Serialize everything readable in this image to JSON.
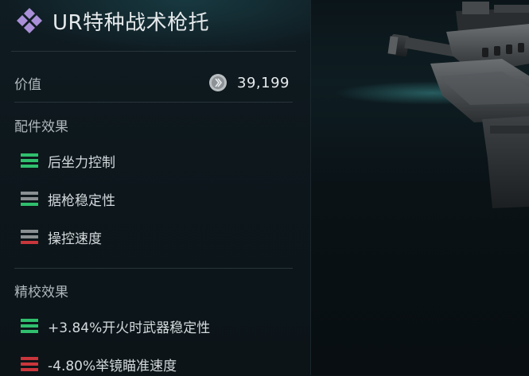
{
  "item": {
    "title": "UR特种战术枪托",
    "rarity_color": "#a98fd8"
  },
  "value": {
    "label": "价值",
    "amount": "39,199",
    "currency_icon": "silver-coin-icon"
  },
  "attachment_effects": {
    "title": "配件效果",
    "items": [
      {
        "label": "后坐力控制",
        "bars": [
          "#2fbf6d",
          "#2fbf6d",
          "#2fbf6d"
        ]
      },
      {
        "label": "据枪稳定性",
        "bars": [
          "#8a8f92",
          "#8a8f92",
          "#2fbf6d"
        ]
      },
      {
        "label": "操控速度",
        "bars": [
          "#8a8f92",
          "#8a8f92",
          "#c9363b"
        ]
      }
    ]
  },
  "calibration_effects": {
    "title": "精校效果",
    "items": [
      {
        "label": "+3.84%开火时武器稳定性",
        "bars": [
          "#2fbf6d",
          "#2fbf6d",
          "#2fbf6d"
        ]
      },
      {
        "label": "-4.80%举镜瞄准速度",
        "bars": [
          "#c9363b",
          "#c9363b",
          "#c9363b"
        ]
      }
    ]
  },
  "colors": {
    "positive": "#2fbf6d",
    "neutral": "#8a8f92",
    "negative": "#c9363b"
  }
}
